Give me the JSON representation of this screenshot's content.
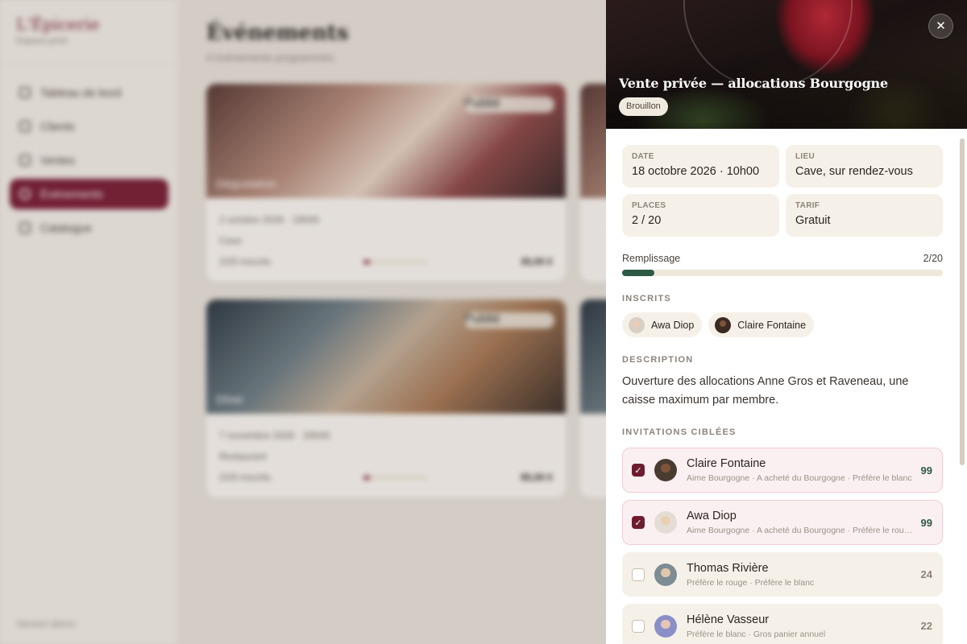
{
  "background": {
    "brand": {
      "name": "L'Épicerie",
      "sub": "Espace privé"
    },
    "nav": [
      {
        "label": "Tableau de bord",
        "active": false
      },
      {
        "label": "Clients",
        "active": false
      },
      {
        "label": "Ventes",
        "active": false
      },
      {
        "label": "Événements",
        "active": true
      },
      {
        "label": "Catalogue",
        "active": false
      }
    ],
    "sidebar_footer": "Version démo",
    "page_title": "Événements",
    "page_subtitle": "4 événements programmés",
    "cards": [
      {
        "title": "Dégustation",
        "badge": "Publié",
        "date": "2 octobre 2026 · 19h00",
        "place": "Cave",
        "registered": "2/20 inscrits",
        "price": "35,00 €",
        "fill": 0.1
      },
      {
        "title": "",
        "badge": "",
        "date": "",
        "place": "",
        "registered": "",
        "price": "",
        "fill": 0
      },
      {
        "title": "Dîner",
        "badge": "Publié",
        "date": "7 novembre 2026 · 20h00",
        "place": "Restaurant",
        "registered": "2/20 inscrits",
        "price": "95,00 €",
        "fill": 0.1
      },
      {
        "title": "",
        "badge": "",
        "date": "",
        "place": "",
        "registered": "",
        "price": "",
        "fill": 0
      }
    ]
  },
  "drawer": {
    "title": "Vente privée — allocations Bourgogne",
    "status": "Brouillon",
    "close_label": "✕",
    "info": {
      "date": {
        "label": "DATE",
        "value": "18 octobre 2026 · 10h00"
      },
      "lieu": {
        "label": "LIEU",
        "value": "Cave, sur rendez-vous"
      },
      "places": {
        "label": "PLACES",
        "value": "2 / 20"
      },
      "tarif": {
        "label": "TARIF",
        "value": "Gratuit"
      }
    },
    "remplissage": {
      "label": "Remplissage",
      "value_text": "2/20",
      "filled": 2,
      "capacity": 20
    },
    "inscrits": {
      "label": "INSCRITS",
      "people": [
        {
          "name": "Awa Diop",
          "avatar_tone": "light"
        },
        {
          "name": "Claire Fontaine",
          "avatar_tone": "dark"
        }
      ]
    },
    "description": {
      "label": "DESCRIPTION",
      "text": "Ouverture des allocations Anne Gros et Raveneau, une caisse maximum par membre."
    },
    "invitations": {
      "label": "INVITATIONS CIBLÉES",
      "items": [
        {
          "name": "Claire Fontaine",
          "tags": "Aime Bourgogne · A acheté du Bourgogne · Préfère le blanc",
          "score": "99",
          "selected": true,
          "avatar_tone": "dark"
        },
        {
          "name": "Awa Diop",
          "tags": "Aime Bourgogne · A acheté du Bourgogne · Préfère le rouge",
          "score": "99",
          "selected": true,
          "avatar_tone": "light"
        },
        {
          "name": "Thomas Rivière",
          "tags": "Préfère le rouge · Préfère le blanc",
          "score": "24",
          "selected": false,
          "avatar_tone": "light"
        },
        {
          "name": "Hélène Vasseur",
          "tags": "Préfère le blanc · Gros panier annuel",
          "score": "22",
          "selected": false,
          "avatar_tone": "light"
        }
      ]
    }
  },
  "colors": {
    "accent": "#7a1f36",
    "fill": "#2d5a45",
    "panel": "#f6f1e8"
  },
  "icons": {
    "close": "close-icon",
    "check": "check-icon"
  }
}
